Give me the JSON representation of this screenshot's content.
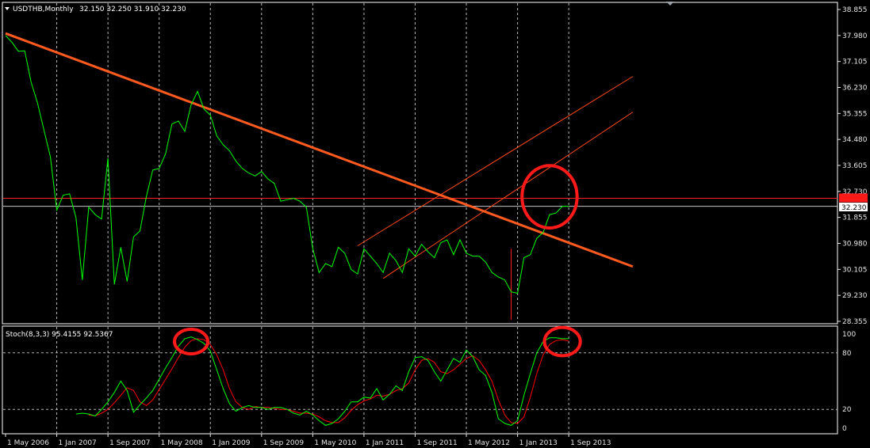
{
  "header": {
    "symbol": "USDTHB,Monthly",
    "ohlc": "32.150 32.250 31.910 32.230"
  },
  "stoch_header": "Stoch(8,3,3) 95.4155 92.5367",
  "colors": {
    "background": "#000000",
    "price_line": "#00ff00",
    "trend_line_main": "#ff5a1f",
    "trend_line_thin": "#ff4a1a",
    "horizontal_level": "#ff2020",
    "circle": "#ff1a1a",
    "stoch_main": "#00ff00",
    "stoch_signal": "#ff0000",
    "grid": "#b4b4b4",
    "axis_text": "#e6e6e6",
    "price_label_bg": "#ff1a1a"
  },
  "current_price_label": "32.230",
  "chart_data": [
    {
      "type": "line",
      "name": "price",
      "title": "USDTHB,Monthly",
      "ylim": [
        28.355,
        38.855
      ],
      "y_ticks": [
        "38.855",
        "37.980",
        "37.105",
        "36.230",
        "35.355",
        "34.480",
        "33.605",
        "32.730",
        "31.855",
        "30.980",
        "30.105",
        "29.230",
        "28.355"
      ],
      "x_ticks": [
        "1 May 2006",
        "1 Jan 2007",
        "1 Sep 2007",
        "1 May 2008",
        "1 Jan 2009",
        "1 Sep 2009",
        "1 May 2010",
        "1 Jan 2011",
        "1 Sep 2011",
        "1 May 2012",
        "1 Jan 2013",
        "1 Sep 2013"
      ],
      "x_start": "2006-05",
      "x": [
        "2006-05",
        "2006-06",
        "2006-07",
        "2006-08",
        "2006-09",
        "2006-10",
        "2006-11",
        "2006-12",
        "2007-01",
        "2007-02",
        "2007-03",
        "2007-04",
        "2007-05",
        "2007-06",
        "2007-07",
        "2007-08",
        "2007-09",
        "2007-10",
        "2007-11",
        "2007-12",
        "2008-01",
        "2008-02",
        "2008-03",
        "2008-04",
        "2008-05",
        "2008-06",
        "2008-07",
        "2008-08",
        "2008-09",
        "2008-10",
        "2008-11",
        "2008-12",
        "2009-01",
        "2009-02",
        "2009-03",
        "2009-04",
        "2009-05",
        "2009-06",
        "2009-07",
        "2009-08",
        "2009-09",
        "2009-10",
        "2009-11",
        "2009-12",
        "2010-01",
        "2010-02",
        "2010-03",
        "2010-04",
        "2010-05",
        "2010-06",
        "2010-07",
        "2010-08",
        "2010-09",
        "2010-10",
        "2010-11",
        "2010-12",
        "2011-01",
        "2011-02",
        "2011-03",
        "2011-04",
        "2011-05",
        "2011-06",
        "2011-07",
        "2011-08",
        "2011-09",
        "2011-10",
        "2011-11",
        "2011-12",
        "2012-01",
        "2012-02",
        "2012-03",
        "2012-04",
        "2012-05",
        "2012-06",
        "2012-07",
        "2012-08",
        "2012-09",
        "2012-10",
        "2012-11",
        "2012-12",
        "2013-01",
        "2013-02",
        "2013-03",
        "2013-04",
        "2013-05",
        "2013-06",
        "2013-07",
        "2013-08",
        "2013-09"
      ],
      "values": [
        37.98,
        37.75,
        37.45,
        37.46,
        36.4,
        35.7,
        34.8,
        33.9,
        32.1,
        32.6,
        32.65,
        31.85,
        29.75,
        32.2,
        31.95,
        31.8,
        33.85,
        29.6,
        30.85,
        29.7,
        31.2,
        31.4,
        32.55,
        33.45,
        33.5,
        34.0,
        35.0,
        35.1,
        34.75,
        35.65,
        36.1,
        35.5,
        35.3,
        34.6,
        34.3,
        34.1,
        33.75,
        33.5,
        33.35,
        33.25,
        33.4,
        33.15,
        33.0,
        32.4,
        32.45,
        32.5,
        32.4,
        32.2,
        30.8,
        30.0,
        30.3,
        30.2,
        30.85,
        30.65,
        30.1,
        29.95,
        30.8,
        30.55,
        30.3,
        30.0,
        30.65,
        30.4,
        30.0,
        30.8,
        30.55,
        30.95,
        30.7,
        30.5,
        31.0,
        31.1,
        30.6,
        31.1,
        30.65,
        30.55,
        30.55,
        30.35,
        30.0,
        29.85,
        29.75,
        29.35,
        29.3,
        30.5,
        30.6,
        31.15,
        31.35,
        31.95,
        32.0,
        32.23,
        32.23
      ]
    },
    {
      "type": "line",
      "name": "stochastic",
      "title": "Stoch(8,3,3) 95.4155 92.5367",
      "ylim": [
        0,
        100
      ],
      "y_ticks": [
        "100",
        "80",
        "20",
        "0"
      ],
      "levels": [
        80,
        20
      ],
      "x": [
        "2006-05",
        "2006-06",
        "2006-07",
        "2006-08",
        "2006-09",
        "2006-10",
        "2006-11",
        "2006-12",
        "2007-01",
        "2007-02",
        "2007-03",
        "2007-04",
        "2007-05",
        "2007-06",
        "2007-07",
        "2007-08",
        "2007-09",
        "2007-10",
        "2007-11",
        "2007-12",
        "2008-01",
        "2008-02",
        "2008-03",
        "2008-04",
        "2008-05",
        "2008-06",
        "2008-07",
        "2008-08",
        "2008-09",
        "2008-10",
        "2008-11",
        "2008-12",
        "2009-01",
        "2009-02",
        "2009-03",
        "2009-04",
        "2009-05",
        "2009-06",
        "2009-07",
        "2009-08",
        "2009-09",
        "2009-10",
        "2009-11",
        "2009-12",
        "2010-01",
        "2010-02",
        "2010-03",
        "2010-04",
        "2010-05",
        "2010-06",
        "2010-07",
        "2010-08",
        "2010-09",
        "2010-10",
        "2010-11",
        "2010-12",
        "2011-01",
        "2011-02",
        "2011-03",
        "2011-04",
        "2011-05",
        "2011-06",
        "2011-07",
        "2011-08",
        "2011-09",
        "2011-10",
        "2011-11",
        "2011-12",
        "2012-01",
        "2012-02",
        "2012-03",
        "2012-04",
        "2012-05",
        "2012-06",
        "2012-07",
        "2012-08",
        "2012-09",
        "2012-10",
        "2012-11",
        "2012-12",
        "2013-01",
        "2013-02",
        "2013-03",
        "2013-04",
        "2013-05",
        "2013-06",
        "2013-07",
        "2013-08",
        "2013-09"
      ],
      "main": [
        null,
        null,
        null,
        null,
        null,
        null,
        null,
        null,
        null,
        null,
        null,
        15,
        16,
        15,
        13,
        20,
        28,
        38,
        50,
        40,
        17,
        25,
        32,
        40,
        52,
        64,
        75,
        87,
        95,
        97,
        94,
        90,
        82,
        62,
        42,
        26,
        18,
        22,
        24,
        22,
        22,
        20,
        22,
        22,
        20,
        16,
        14,
        18,
        14,
        8,
        3,
        5,
        10,
        18,
        28,
        28,
        33,
        32,
        42,
        30,
        36,
        45,
        40,
        60,
        75,
        76,
        72,
        60,
        50,
        62,
        74,
        70,
        83,
        76,
        62,
        56,
        38,
        10,
        5,
        3,
        8,
        35,
        58,
        80,
        92,
        96,
        96,
        95,
        95
      ],
      "signal": [
        null,
        null,
        null,
        null,
        null,
        null,
        null,
        null,
        null,
        null,
        null,
        null,
        null,
        14,
        13,
        16,
        20,
        27,
        35,
        43,
        40,
        28,
        24,
        30,
        41,
        52,
        63,
        75,
        86,
        93,
        95,
        94,
        89,
        78,
        62,
        42,
        28,
        22,
        20,
        23,
        22,
        22,
        21,
        20,
        20,
        18,
        16,
        16,
        15,
        12,
        8,
        6,
        6,
        11,
        19,
        25,
        29,
        31,
        35,
        34,
        36,
        40,
        42,
        48,
        62,
        72,
        74,
        70,
        60,
        58,
        62,
        68,
        74,
        77,
        72,
        62,
        50,
        30,
        14,
        6,
        5,
        12,
        33,
        58,
        78,
        89,
        93,
        94,
        92.5
      ]
    }
  ],
  "annotations": {
    "main_trend_line": {
      "from": {
        "x": "2006-05",
        "y": 38.05
      },
      "to": {
        "x": "2014-07",
        "y": 30.2
      }
    },
    "channel_upper": {
      "from": {
        "x": "2010-12",
        "y": 30.9
      },
      "to": {
        "x": "2014-07",
        "y": 36.6
      }
    },
    "channel_lower": {
      "from": {
        "x": "2011-04",
        "y": 29.8
      },
      "to": {
        "x": "2014-07",
        "y": 35.4
      }
    },
    "horizontal_levels": [
      32.5,
      32.23
    ],
    "vertical_marker": {
      "x": "2012-12",
      "from": 28.4,
      "to": 30.8
    },
    "circles": [
      {
        "panel": "price",
        "x": "2013-06",
        "y": 32.55,
        "rx_months": 4.3,
        "ry_value": 1.05
      },
      {
        "panel": "stochastic",
        "x": "2008-10",
        "y": 92,
        "rx_months": 2.6,
        "ry_value": 13
      },
      {
        "panel": "stochastic",
        "x": "2013-08",
        "y": 92,
        "rx_months": 2.8,
        "ry_value": 15
      }
    ]
  }
}
